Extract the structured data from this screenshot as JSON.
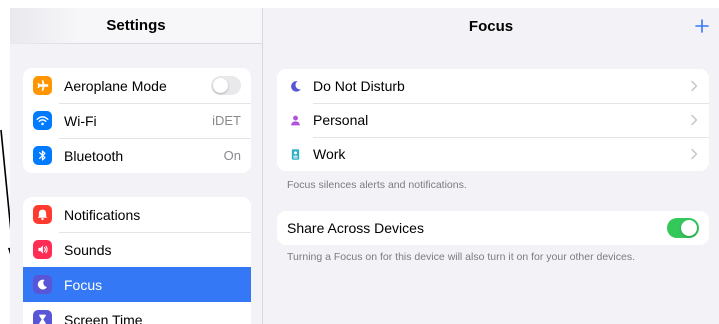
{
  "sidebar": {
    "title": "Settings",
    "group1": [
      {
        "label": "Aeroplane Mode",
        "value": "",
        "icon": "airplane-icon",
        "color": "#ff9500",
        "control": "toggle-off"
      },
      {
        "label": "Wi-Fi",
        "value": "iDET",
        "icon": "wifi-icon",
        "color": "#007aff"
      },
      {
        "label": "Bluetooth",
        "value": "On",
        "icon": "bluetooth-icon",
        "color": "#007aff"
      }
    ],
    "group2": [
      {
        "label": "Notifications",
        "icon": "bell-icon",
        "color": "#ff3b30"
      },
      {
        "label": "Sounds",
        "icon": "speaker-icon",
        "color": "#ff2d55"
      },
      {
        "label": "Focus",
        "icon": "moon-icon",
        "color": "#5856d6",
        "selected": true
      },
      {
        "label": "Screen Time",
        "icon": "hourglass-icon",
        "color": "#5856d6"
      }
    ]
  },
  "main": {
    "title": "Focus",
    "add_icon": "plus-icon",
    "focus_modes": [
      {
        "label": "Do Not Disturb",
        "icon": "moon-icon",
        "color": "#5856d6"
      },
      {
        "label": "Personal",
        "icon": "person-icon",
        "color": "#af52de"
      },
      {
        "label": "Work",
        "icon": "badge-icon",
        "color": "#30b0c7"
      }
    ],
    "focus_note": "Focus silences alerts and notifications.",
    "share": {
      "label": "Share Across Devices",
      "enabled": true,
      "note": "Turning a Focus on for this device will also turn it on for your other devices."
    }
  },
  "colors": {
    "accent": "#3478f6",
    "toggle_on": "#34c759",
    "background": "#f2f2f7"
  }
}
